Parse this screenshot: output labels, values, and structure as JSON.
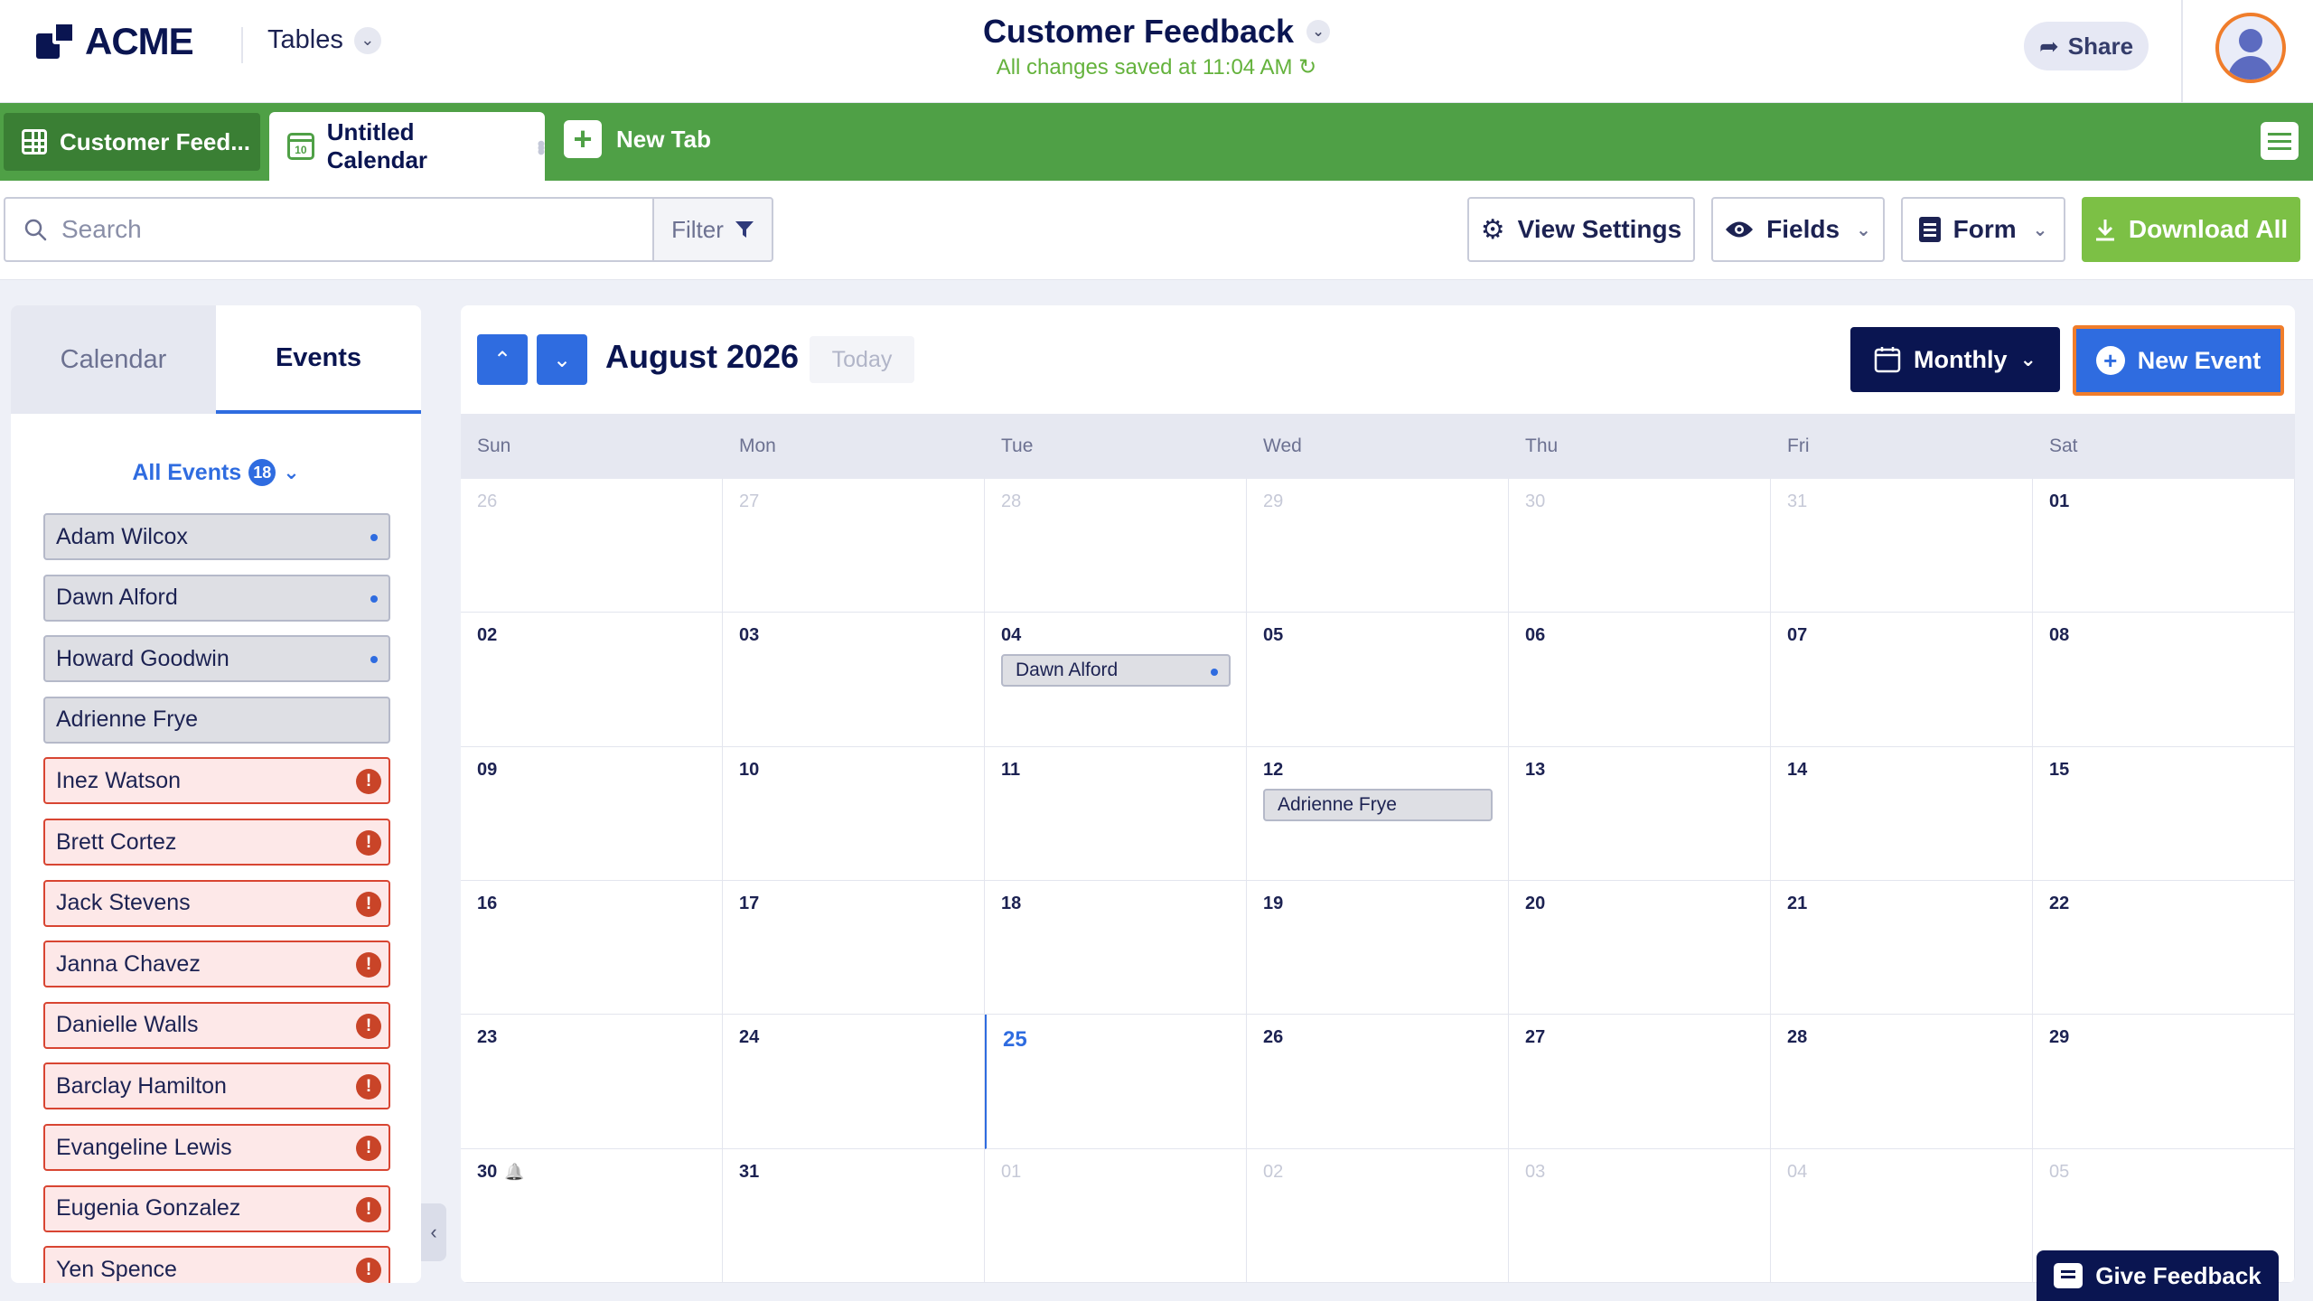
{
  "header": {
    "logo_text": "ACME",
    "tables_label": "Tables",
    "doc_title": "Customer Feedback",
    "save_status": "All changes saved at 11:04 AM",
    "share_label": "Share"
  },
  "tabs": {
    "first": "Customer Feed...",
    "active": "Untitled Calendar",
    "calendar_icon_day": "10",
    "new_tab": "New Tab"
  },
  "toolbar": {
    "search_placeholder": "Search",
    "filter_label": "Filter",
    "view_settings": "View Settings",
    "fields": "Fields",
    "form": "Form",
    "download_all": "Download All"
  },
  "left_panel": {
    "tab_calendar": "Calendar",
    "tab_events": "Events",
    "all_events_label": "All Events",
    "all_events_count": "18",
    "events": [
      {
        "name": "Adam Wilcox",
        "status": "dot"
      },
      {
        "name": "Dawn Alford",
        "status": "dot"
      },
      {
        "name": "Howard Goodwin",
        "status": "dot"
      },
      {
        "name": "Adrienne Frye",
        "status": "none"
      },
      {
        "name": "Inez Watson",
        "status": "error"
      },
      {
        "name": "Brett Cortez",
        "status": "error"
      },
      {
        "name": "Jack Stevens",
        "status": "error"
      },
      {
        "name": "Janna Chavez",
        "status": "error"
      },
      {
        "name": "Danielle Walls",
        "status": "error"
      },
      {
        "name": "Barclay Hamilton",
        "status": "error"
      },
      {
        "name": "Evangeline Lewis",
        "status": "error"
      },
      {
        "name": "Eugenia Gonzalez",
        "status": "error"
      },
      {
        "name": "Yen Spence",
        "status": "error"
      }
    ]
  },
  "calendar": {
    "month_title": "August 2026",
    "today_label": "Today",
    "view_mode": "Monthly",
    "new_event_label": "New Event",
    "weekdays": [
      "Sun",
      "Mon",
      "Tue",
      "Wed",
      "Thu",
      "Fri",
      "Sat"
    ],
    "weeks": [
      [
        {
          "d": "26",
          "out": true
        },
        {
          "d": "27",
          "out": true
        },
        {
          "d": "28",
          "out": true
        },
        {
          "d": "29",
          "out": true
        },
        {
          "d": "30",
          "out": true
        },
        {
          "d": "31",
          "out": true
        },
        {
          "d": "01"
        }
      ],
      [
        {
          "d": "02"
        },
        {
          "d": "03"
        },
        {
          "d": "04",
          "event": "Dawn Alford",
          "event_dot": true
        },
        {
          "d": "05"
        },
        {
          "d": "06"
        },
        {
          "d": "07"
        },
        {
          "d": "08"
        }
      ],
      [
        {
          "d": "09"
        },
        {
          "d": "10"
        },
        {
          "d": "11"
        },
        {
          "d": "12",
          "event": "Adrienne Frye"
        },
        {
          "d": "13"
        },
        {
          "d": "14"
        },
        {
          "d": "15"
        }
      ],
      [
        {
          "d": "16"
        },
        {
          "d": "17"
        },
        {
          "d": "18"
        },
        {
          "d": "19"
        },
        {
          "d": "20"
        },
        {
          "d": "21"
        },
        {
          "d": "22"
        }
      ],
      [
        {
          "d": "23"
        },
        {
          "d": "24"
        },
        {
          "d": "25",
          "today": true
        },
        {
          "d": "26"
        },
        {
          "d": "27"
        },
        {
          "d": "28"
        },
        {
          "d": "29"
        }
      ],
      [
        {
          "d": "30",
          "bell": true
        },
        {
          "d": "31"
        },
        {
          "d": "01",
          "out": true
        },
        {
          "d": "02",
          "out": true
        },
        {
          "d": "03",
          "out": true
        },
        {
          "d": "04",
          "out": true
        },
        {
          "d": "05",
          "out": true
        }
      ]
    ]
  },
  "feedback_label": "Give Feedback",
  "colors": {
    "brand_navy": "#0a1551",
    "tab_green": "#4fa046",
    "accent_blue": "#2f6ce0",
    "highlight_orange": "#f07d2b",
    "error_red": "#c94428"
  }
}
